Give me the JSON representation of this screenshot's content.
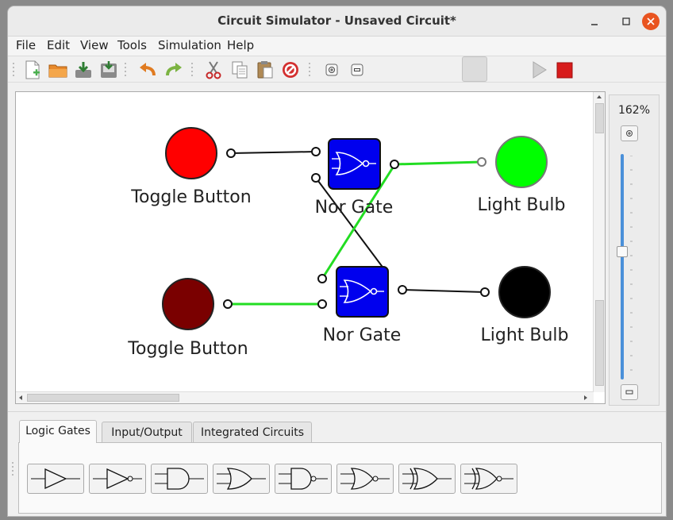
{
  "window": {
    "title": "Circuit Simulator - Unsaved Circuit*"
  },
  "menu": [
    "File",
    "Edit",
    "View",
    "Tools",
    "Simulation",
    "Help"
  ],
  "toolbar": {
    "buttons": [
      "new-file-icon",
      "open-folder-icon",
      "save-icon",
      "save-as-icon",
      "undo-icon",
      "redo-icon",
      "cut-icon",
      "copy-icon",
      "paste-icon",
      "delete-icon",
      "zoom-in-icon",
      "zoom-out-icon",
      "blank-button",
      "play-icon",
      "stop-icon"
    ]
  },
  "circuit": {
    "components": [
      {
        "type": "toggle-button",
        "label": "Toggle Button",
        "color": "#ff0000"
      },
      {
        "type": "toggle-button",
        "label": "Toggle Button",
        "color": "#7a0000"
      },
      {
        "type": "nor-gate",
        "label": "Nor Gate",
        "color": "#0000ee"
      },
      {
        "type": "nor-gate",
        "label": "Nor Gate",
        "color": "#0000ee"
      },
      {
        "type": "light-bulb",
        "label": "Light Bulb",
        "color": "#00ff00"
      },
      {
        "type": "light-bulb",
        "label": "Light Bulb",
        "color": "#000000"
      }
    ],
    "wire_active_color": "#22dd22",
    "wire_inactive_color": "#111111"
  },
  "zoom": {
    "value": "162%"
  },
  "palette": {
    "tabs": [
      "Logic Gates",
      "Input/Output",
      "Integrated Circuits"
    ],
    "active_tab": "Logic Gates",
    "gates": [
      "buffer-gate-icon",
      "not-gate-icon",
      "and-gate-icon",
      "or-gate-icon",
      "nand-gate-icon",
      "nor-gate-icon",
      "xor-gate-icon",
      "xnor-gate-icon"
    ]
  }
}
